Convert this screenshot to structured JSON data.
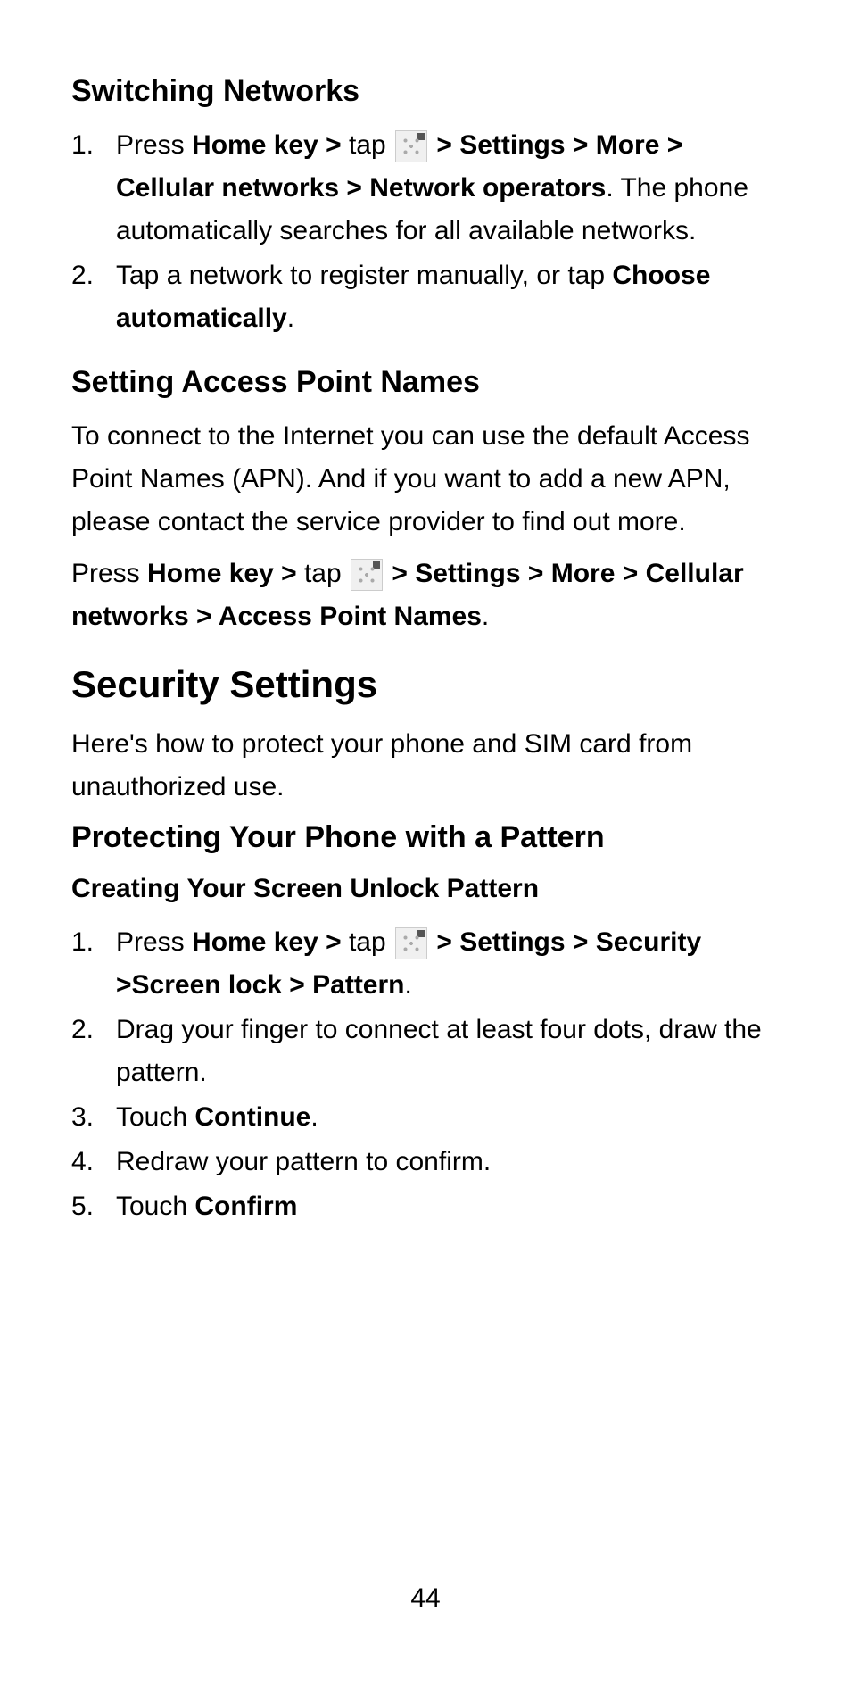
{
  "sec1": {
    "heading": "Switching Networks",
    "list": [
      {
        "num": "1.",
        "parts": {
          "a": "Press ",
          "b": "Home key > ",
          "c": "tap ",
          "d": " > Settings > More > Cellular networks > Network operators",
          "e": ". The phone automatically searches for all available networks."
        }
      },
      {
        "num": "2.",
        "parts": {
          "a": "Tap a network to register manually, or tap ",
          "b": "Choose automatically",
          "c": "."
        }
      }
    ]
  },
  "sec2": {
    "heading": "Setting Access Point Names",
    "p1": "To connect to the Internet you can use the default Access Point Names (APN). And if you want to add a new APN, please contact the service provider to find out more.",
    "p2": {
      "a": "Press ",
      "b": "Home key > ",
      "c": "tap ",
      "d": " > Settings > More > Cellular networks > Access Point Names",
      "e": "."
    }
  },
  "sec3": {
    "heading": "Security Settings",
    "p1": "Here's how to protect your phone and SIM card from unauthorized use."
  },
  "sec4": {
    "heading": "Protecting Your Phone with a Pattern",
    "subheading": "Creating Your Screen Unlock Pattern",
    "list": [
      {
        "num": "1.",
        "parts": {
          "a": "Press ",
          "b": "Home key > ",
          "c": "tap ",
          "d": " > Settings > Security >Screen lock > Pattern",
          "e": "."
        }
      },
      {
        "num": "2.",
        "text": "Drag your finger to connect at least four dots, draw the pattern."
      },
      {
        "num": "3.",
        "parts": {
          "a": "Touch ",
          "b": "Continue",
          "c": "."
        }
      },
      {
        "num": "4.",
        "text": "Redraw your pattern to confirm."
      },
      {
        "num": "5.",
        "parts": {
          "a": "Touch ",
          "b": "Confirm"
        }
      }
    ]
  },
  "pageNumber": "44"
}
